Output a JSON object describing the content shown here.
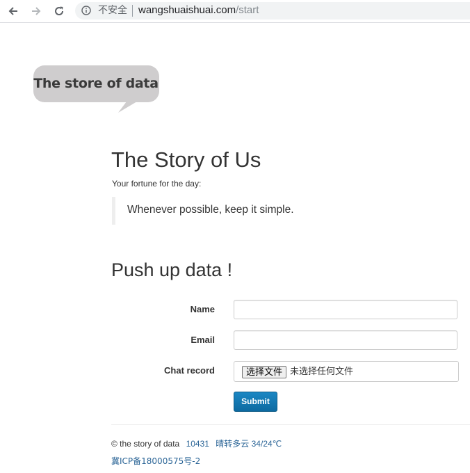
{
  "browser": {
    "security_label": "不安全",
    "url_host": "wangshuaishuai.com",
    "url_path": "/start",
    "icons": [
      "back-icon",
      "forward-icon",
      "reload-icon",
      "info-icon"
    ]
  },
  "logo": {
    "text": "The store of data"
  },
  "intro": {
    "title": "The Story of Us",
    "fortune_label": "Your fortune for the day:",
    "fortune_quote": "Whenever possible, keep it simple."
  },
  "form": {
    "heading": "Push up data !",
    "name_label": "Name",
    "name_value": "",
    "email_label": "Email",
    "email_value": "",
    "chat_label": "Chat record",
    "file_button": "选择文件",
    "file_status": "未选择任何文件",
    "submit_label": "Submit"
  },
  "footer": {
    "copyright": "© the story of data",
    "visit_count": "10431",
    "weather": "晴转多云 34/24℃",
    "icp": "冀ICP备18000575号-2"
  },
  "colors": {
    "link": "#2a6496",
    "button": "#1a7cb8",
    "logo_bubble": "#cfcdce"
  }
}
